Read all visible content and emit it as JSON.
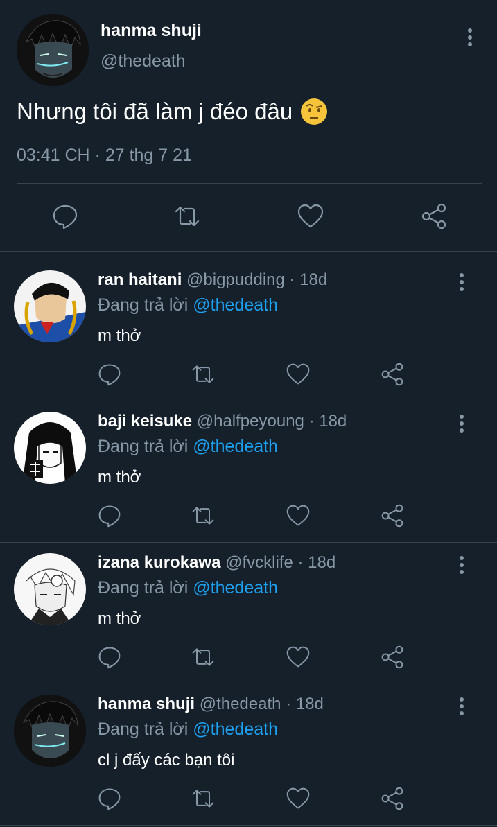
{
  "main_tweet": {
    "author_name": "hanma shuji",
    "author_handle": "@thedeath",
    "text": "Nhưng tôi đã làm j đéo đâu",
    "emoji_icon": "raised-eyebrow-emoji-icon",
    "timestamp": "03:41 CH · 27 thg 7 21",
    "actions": [
      "reply-icon",
      "retweet-icon",
      "like-icon",
      "share-icon"
    ]
  },
  "replies": [
    {
      "author_name": "ran haitani",
      "author_handle": "@bigpudding",
      "age": "· 18d",
      "replying_prefix": "Đang trả lời",
      "replying_to": "@thedeath",
      "text": "m thở",
      "avatar_icon": "anime-avatar-braids"
    },
    {
      "author_name": "baji keisuke",
      "author_handle": "@halfpeyoung",
      "age": "· 18d",
      "replying_prefix": "Đang trả lời",
      "replying_to": "@thedeath",
      "text": "m thở",
      "avatar_icon": "anime-avatar-longhair"
    },
    {
      "author_name": "izana kurokawa",
      "author_handle": "@fvcklife",
      "age": "· 18d",
      "replying_prefix": "Đang trả lời",
      "replying_to": "@thedeath",
      "text": "m thở",
      "avatar_icon": "anime-avatar-whitehair"
    },
    {
      "author_name": "hanma shuji",
      "author_handle": "@thedeath",
      "age": "· 18d",
      "replying_prefix": "Đang trả lời",
      "replying_to": "@thedeath",
      "text": "cl j đấy các bạn tôi",
      "avatar_icon": "anime-avatar-dark"
    }
  ],
  "colors": {
    "background": "#15202b",
    "secondary_text": "#8899a6",
    "link": "#1da1f2",
    "divider": "#38444d"
  }
}
